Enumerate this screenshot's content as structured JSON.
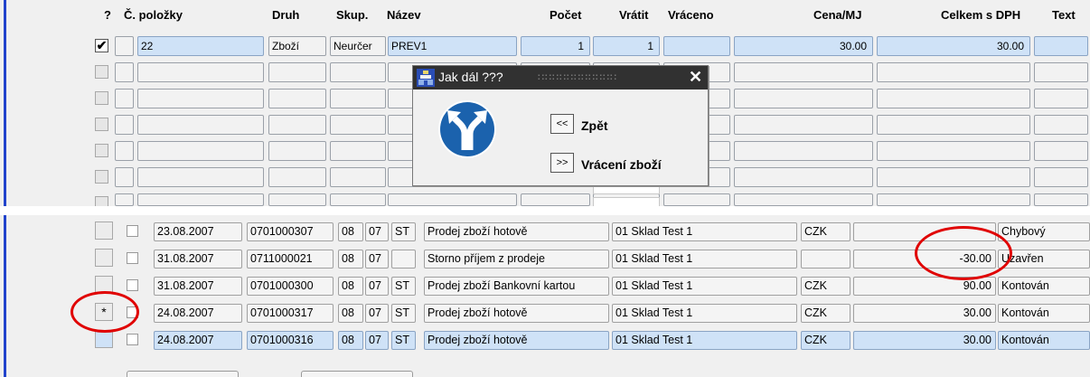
{
  "top": {
    "headers": {
      "q": "?",
      "polozky": "Č. položky",
      "druh": "Druh",
      "skup": "Skup.",
      "nazev": "Název",
      "pocet": "Počet",
      "vratit": "Vrátit",
      "vraceno": "Vráceno",
      "cena": "Cena/MJ",
      "celkem": "Celkem s DPH",
      "text": "Text"
    },
    "row1": {
      "checked": "✔",
      "polozka": "22",
      "druh": "Zboží",
      "skup": "Neurčer",
      "nazev": "PREV1",
      "pocet": "1",
      "vratit": "1",
      "vraceno": "",
      "cena": "30.00",
      "celkem": "30.00"
    }
  },
  "dialog": {
    "title": "Jak dál ???",
    "title_dots": "∷∷∷∷∷∷∷∷∷∷∷",
    "close": "✕",
    "back_btn": "<<",
    "back_label": "Zpět",
    "forward_btn": ">>",
    "forward_label": "Vrácení zboží",
    "icon": "split-road-sign-icon"
  },
  "bottom": {
    "rows": [
      {
        "mark": "",
        "date": "23.08.2007",
        "doc": "0701000307",
        "a": "08",
        "b": "07",
        "c": "ST",
        "desc": "Prodej zboží hotově",
        "store": "01 Sklad Test 1",
        "cur": "CZK",
        "amount": "",
        "status": "Chybový"
      },
      {
        "mark": "",
        "date": "31.08.2007",
        "doc": "0711000021",
        "a": "08",
        "b": "07",
        "c": "",
        "desc": "Storno příjem z prodeje",
        "store": "01 Sklad Test 1",
        "cur": "",
        "amount": "-30.00",
        "status": "Uzavřen"
      },
      {
        "mark": "",
        "date": "31.08.2007",
        "doc": "0701000300",
        "a": "08",
        "b": "07",
        "c": "ST",
        "desc": "Prodej zboží Bankovní kartou",
        "store": "01 Sklad Test 1",
        "cur": "CZK",
        "amount": "90.00",
        "status": "Kontován"
      },
      {
        "mark": "*",
        "date": "24.08.2007",
        "doc": "0701000317",
        "a": "08",
        "b": "07",
        "c": "ST",
        "desc": "Prodej zboží hotově",
        "store": "01 Sklad Test 1",
        "cur": "CZK",
        "amount": "30.00",
        "status": "Kontován"
      },
      {
        "mark": "",
        "date": "24.08.2007",
        "doc": "0701000316",
        "a": "08",
        "b": "07",
        "c": "ST",
        "desc": "Prodej zboží hotově",
        "store": "01 Sklad Test 1",
        "cur": "CZK",
        "amount": "30.00",
        "status": "Kontován"
      }
    ]
  },
  "colors": {
    "accent_blue": "#2244cc",
    "selected_row": "#cfe2f7",
    "annotation_red": "#e00000",
    "dialog_title_bg": "#313131"
  }
}
